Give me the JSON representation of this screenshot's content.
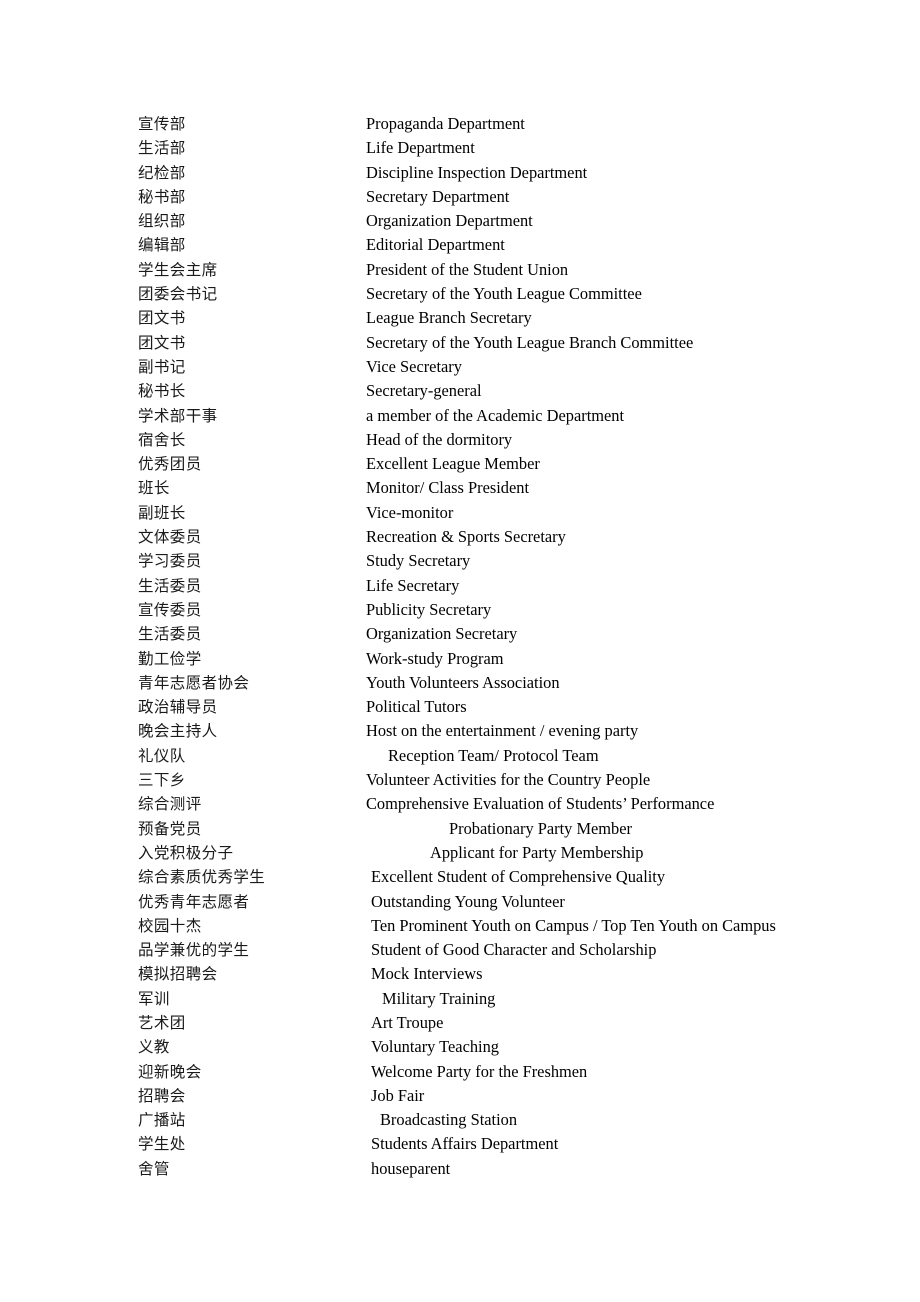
{
  "document": {
    "type": "bilingual-glossary",
    "background_color": "#ffffff",
    "text_color": "#000000",
    "column_headers_visible": false
  },
  "glossary": {
    "rows": [
      {
        "zh": "宣传部",
        "en": "Propaganda Department",
        "indent": 0
      },
      {
        "zh": "生活部",
        "en": "Life Department",
        "indent": 0
      },
      {
        "zh": "纪检部",
        "en": "Discipline Inspection Department",
        "indent": 0
      },
      {
        "zh": "秘书部",
        "en": "Secretary Department",
        "indent": 0
      },
      {
        "zh": "组织部",
        "en": "Organization Department",
        "indent": 0
      },
      {
        "zh": "编辑部",
        "en": "Editorial Department",
        "indent": 0
      },
      {
        "zh": "学生会主席",
        "en": "President of the Student Union",
        "indent": 0
      },
      {
        "zh": "团委会书记",
        "en": "Secretary of the Youth League Committee",
        "indent": 0
      },
      {
        "zh": "团文书",
        "en": "League Branch Secretary",
        "indent": 0
      },
      {
        "zh": "团文书",
        "en": "Secretary of the Youth League Branch Committee",
        "indent": 0
      },
      {
        "zh": "副书记",
        "en": "Vice Secretary",
        "indent": 0
      },
      {
        "zh": "秘书长",
        "en": "Secretary-general",
        "indent": 0
      },
      {
        "zh": "学术部干事",
        "en": "a member of the Academic Department",
        "indent": 0
      },
      {
        "zh": "宿舍长",
        "en": "Head of the dormitory",
        "indent": 0
      },
      {
        "zh": "优秀团员",
        "en": "Excellent League Member",
        "indent": 0
      },
      {
        "zh": "班长",
        "en": "Monitor/ Class President",
        "indent": 0
      },
      {
        "zh": "副班长",
        "en": "Vice-monitor",
        "indent": 0
      },
      {
        "zh": "文体委员",
        "en": "Recreation & Sports Secretary",
        "indent": 0
      },
      {
        "zh": "学习委员",
        "en": "Study Secretary",
        "indent": 0
      },
      {
        "zh": "生活委员",
        "en": "Life Secretary",
        "indent": 0
      },
      {
        "zh": "宣传委员",
        "en": "Publicity Secretary",
        "indent": 0
      },
      {
        "zh": "生活委员",
        "en": "Organization Secretary",
        "indent": 0
      },
      {
        "zh": "勤工俭学",
        "en": "Work-study Program",
        "indent": 0
      },
      {
        "zh": "青年志愿者协会",
        "en": "Youth Volunteers Association",
        "indent": 0
      },
      {
        "zh": "政治辅导员",
        "en": "Political Tutors",
        "indent": 0
      },
      {
        "zh": "晚会主持人",
        "en": "Host on the entertainment / evening party",
        "indent": 0
      },
      {
        "zh": "礼仪队",
        "en": "Reception Team/ Protocol Team",
        "indent": 22
      },
      {
        "zh": "三下乡",
        "en": "Volunteer Activities for the Country People",
        "indent": 0
      },
      {
        "zh": "综合测评",
        "en": "Comprehensive Evaluation of Students’ Performance",
        "indent": 0
      },
      {
        "zh": "预备党员",
        "en": "Probationary Party Member",
        "indent": 83
      },
      {
        "zh": "入党积极分子",
        "en": "Applicant for Party Membership",
        "indent": 64
      },
      {
        "zh": "综合素质优秀学生",
        "en": "Excellent Student of Comprehensive Quality",
        "indent": 5
      },
      {
        "zh": "优秀青年志愿者",
        "en": "Outstanding Young Volunteer",
        "indent": 5
      },
      {
        "zh": "校园十杰",
        "en": "Ten Prominent Youth on Campus / Top Ten Youth on Campus",
        "indent": 5
      },
      {
        "zh": "品学兼优的学生",
        "en": "Student of Good Character and Scholarship",
        "indent": 5
      },
      {
        "zh": "模拟招聘会",
        "en": "Mock Interviews",
        "indent": 5
      },
      {
        "zh": "军训",
        "en": "Military Training",
        "indent": 16
      },
      {
        "zh": "艺术团",
        "en": "Art Troupe",
        "indent": 5
      },
      {
        "zh": "义教",
        "en": "Voluntary Teaching",
        "indent": 5
      },
      {
        "zh": "迎新晚会",
        "en": "Welcome Party for the Freshmen",
        "indent": 5
      },
      {
        "zh": "招聘会",
        "en": "Job Fair",
        "indent": 5
      },
      {
        "zh": "广播站",
        "en": "Broadcasting Station",
        "indent": 14
      },
      {
        "zh": "学生处",
        "en": "Students Affairs Department",
        "indent": 5
      },
      {
        "zh": "舍管",
        "en": "houseparent",
        "indent": 5
      }
    ]
  }
}
